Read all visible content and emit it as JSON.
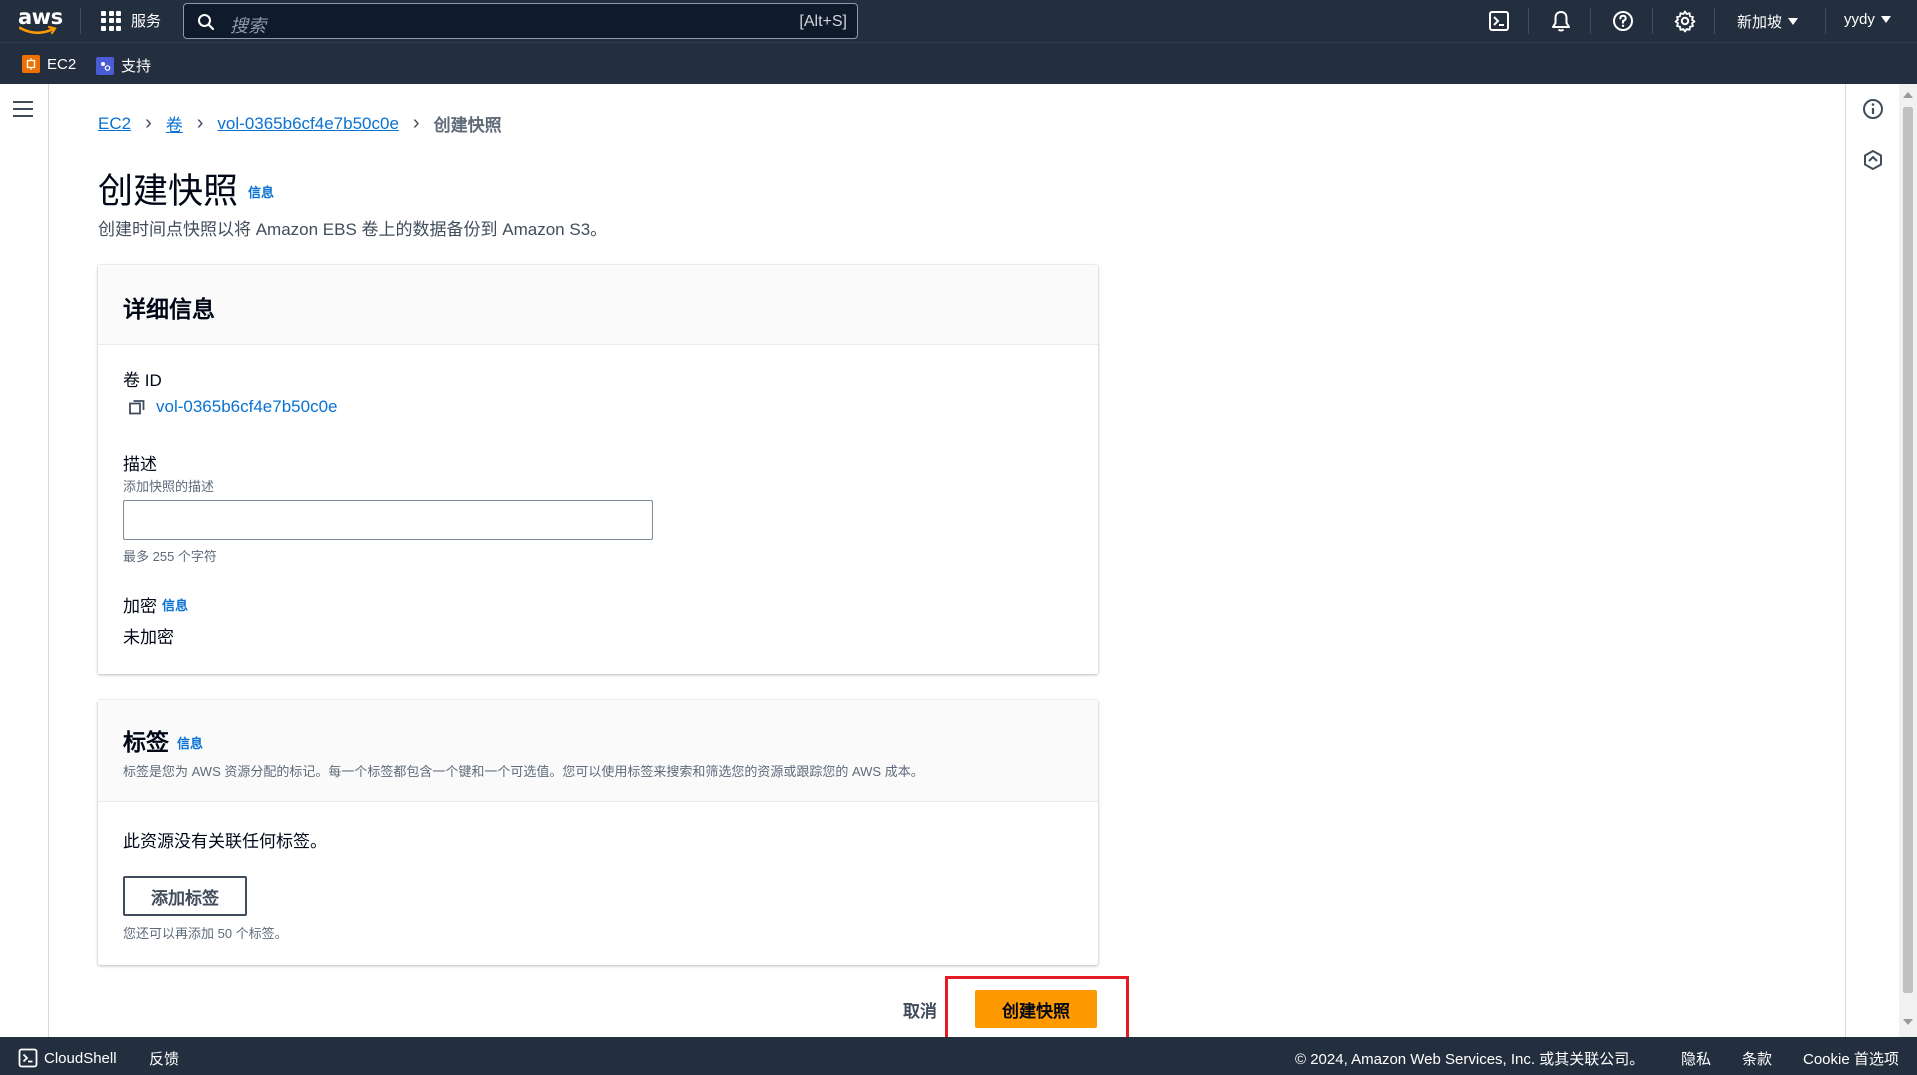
{
  "topnav": {
    "logo_text": "aws",
    "services_label": "服务",
    "search_placeholder": "搜索",
    "search_shortcut": "[Alt+S]",
    "region": "新加坡",
    "user": "yydy"
  },
  "favorites": [
    {
      "label": "EC2",
      "color": "#ed7100"
    },
    {
      "label": "支持",
      "color": "#4a5bd6"
    }
  ],
  "breadcrumb": {
    "items": [
      "EC2",
      "卷",
      "vol-0365b6cf4e7b50c0e"
    ],
    "current": "创建快照"
  },
  "page": {
    "title": "创建快照",
    "info": "信息",
    "subtitle": "创建时间点快照以将 Amazon EBS 卷上的数据备份到 Amazon S3。"
  },
  "details": {
    "header": "详细信息",
    "volume_id_label": "卷 ID",
    "volume_id": "vol-0365b6cf4e7b50c0e",
    "description_label": "描述",
    "description_hint": "添加快照的描述",
    "description_value": "",
    "description_constraint": "最多 255 个字符",
    "encryption_label": "加密",
    "encryption_info": "信息",
    "encryption_value": "未加密"
  },
  "tags": {
    "header": "标签",
    "info": "信息",
    "description": "标签是您为 AWS 资源分配的标记。每一个标签都包含一个键和一个可选值。您可以使用标签来搜索和筛选您的资源或跟踪您的 AWS 成本。",
    "empty_text": "此资源没有关联任何标签。",
    "add_button": "添加标签",
    "remaining": "您还可以再添加 50 个标签。"
  },
  "actions": {
    "cancel": "取消",
    "primary": "创建快照"
  },
  "footer": {
    "cloudshell": "CloudShell",
    "feedback": "反馈",
    "copyright": "© 2024, Amazon Web Services, Inc. 或其关联公司。",
    "privacy": "隐私",
    "terms": "条款",
    "cookie": "Cookie 首选项"
  },
  "colors": {
    "nav_bg": "#232f3e",
    "link": "#0972d3",
    "primary": "#ff9900",
    "highlight": "#e31b23"
  }
}
